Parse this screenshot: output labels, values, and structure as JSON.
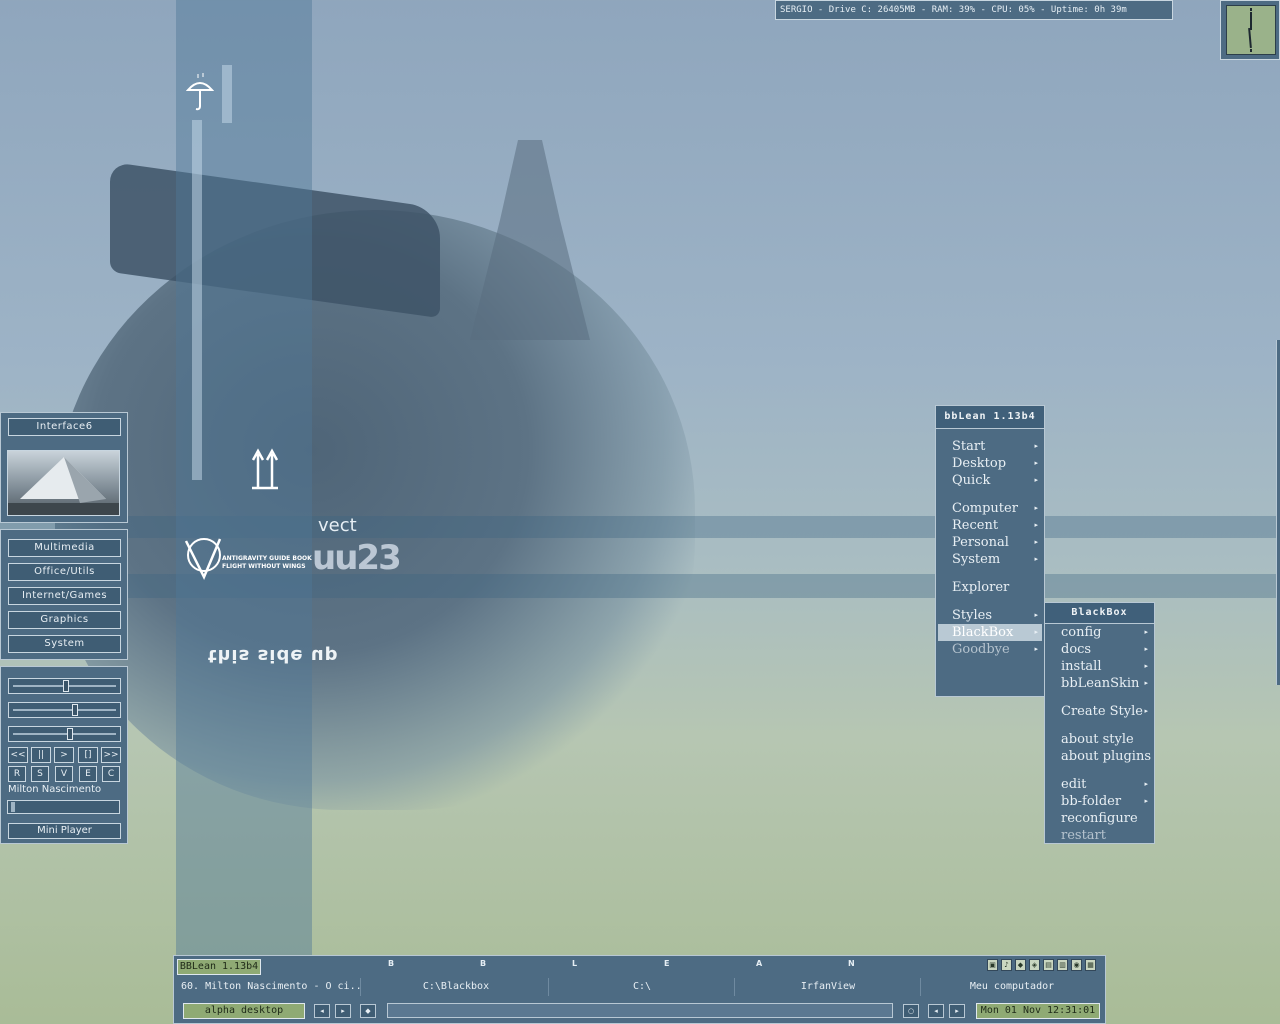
{
  "sysinfo": {
    "text": "SERGIO - Drive C: 26405MB - RAM: 39% - CPU: 05% - Uptime: 0h 39m"
  },
  "wallpaper": {
    "flip_text": "this side up",
    "logo_line1": "ANTIGRAVITY GUIDE BOOK",
    "logo_line2": "FLIGHT WITHOUT WINGS",
    "vect": "vect",
    "big_num": "uu23"
  },
  "left_panel": {
    "title": "Interface6",
    "buttons": [
      "Multimedia",
      "Office/Utils",
      "Internet/Games",
      "Graphics",
      "System"
    ]
  },
  "player": {
    "controls": [
      "<<",
      "||",
      ">",
      "[]",
      ">>"
    ],
    "options": [
      "R",
      "S",
      "V",
      "E",
      "C"
    ],
    "track": "Milton Nascimento",
    "label": "Mini Player",
    "sliders": [
      0.5,
      0.6,
      0.55
    ]
  },
  "main_menu": {
    "title": "bbLean 1.13b4",
    "items": [
      {
        "label": "Start",
        "submenu": true
      },
      {
        "label": "Desktop",
        "submenu": true
      },
      {
        "label": "Quick",
        "submenu": true
      },
      {
        "label": "Computer",
        "submenu": true
      },
      {
        "label": "Recent",
        "submenu": true
      },
      {
        "label": "Personal",
        "submenu": true
      },
      {
        "label": "System",
        "submenu": true
      },
      {
        "label": "Explorer",
        "submenu": false
      },
      {
        "label": "Styles",
        "submenu": true
      },
      {
        "label": "BlackBox",
        "submenu": true
      },
      {
        "label": "Goodbye",
        "submenu": true
      }
    ]
  },
  "blackbox_menu": {
    "title": "BlackBox",
    "items": [
      {
        "label": "config",
        "submenu": true
      },
      {
        "label": "docs",
        "submenu": true
      },
      {
        "label": "install",
        "submenu": true
      },
      {
        "label": "bbLeanSkin",
        "submenu": true
      },
      {
        "label": "Create Style",
        "submenu": true
      },
      {
        "label": "about style",
        "submenu": false
      },
      {
        "label": "about plugins",
        "submenu": false
      },
      {
        "label": "edit",
        "submenu": true
      },
      {
        "label": "bb-folder",
        "submenu": true
      },
      {
        "label": "reconfigure",
        "submenu": false
      },
      {
        "label": "restart",
        "submenu": false
      }
    ]
  },
  "taskbar": {
    "version": "BBLean 1.13b4",
    "letters": [
      "B",
      "B",
      "L",
      "E",
      "A",
      "N"
    ],
    "tasks": [
      "60. Milton Nascimento - O ci...",
      "C:\\Blackbox",
      "C:\\",
      "IrfanView",
      "Meu computador"
    ],
    "workspace": "alpha desktop",
    "clock": "Mon 01 Nov 12:31:01",
    "tray_icons": [
      "net-icon",
      "volume-icon",
      "app-icon",
      "app-icon",
      "app-icon",
      "app-icon",
      "app-icon",
      "app-icon",
      "app-icon"
    ]
  },
  "colors": {
    "panel": "#4d6b83",
    "border": "#b8c8d4",
    "label_green": "#8faa74"
  }
}
